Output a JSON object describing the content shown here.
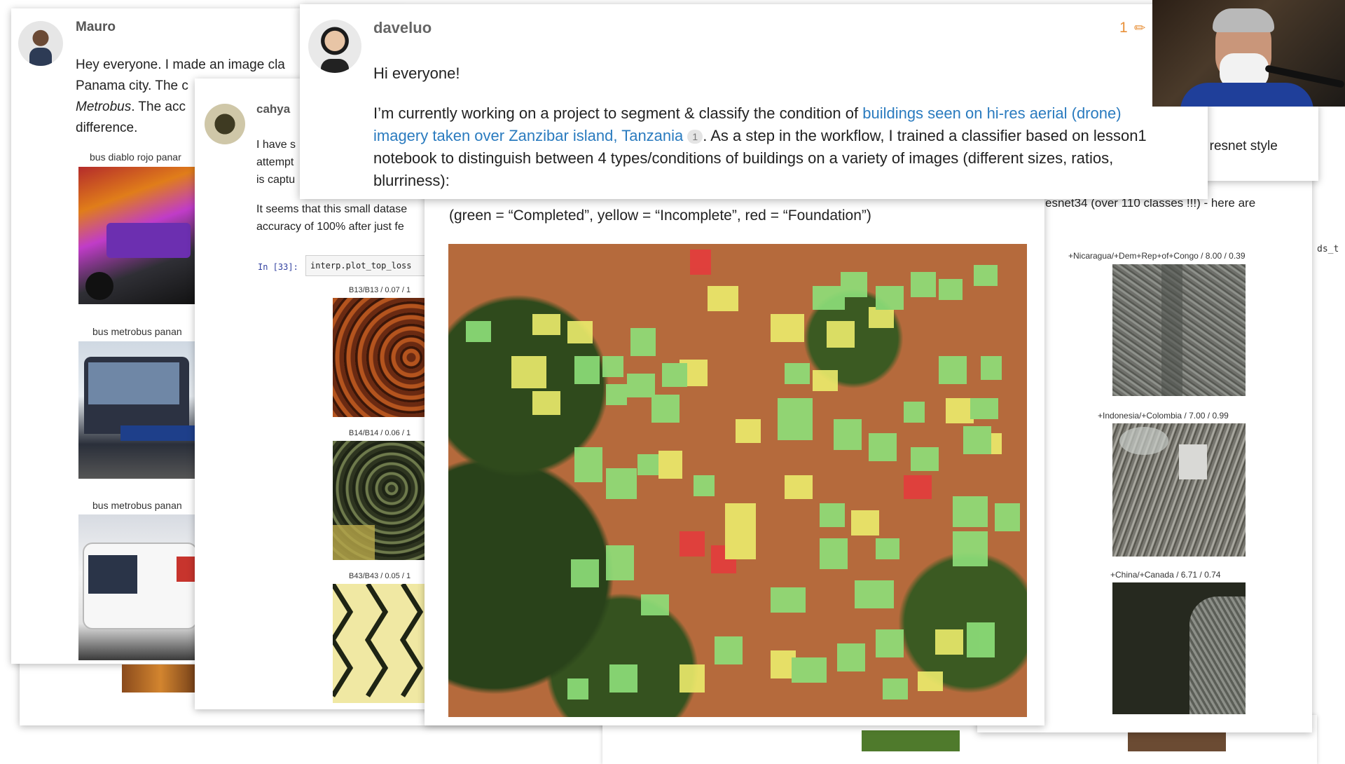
{
  "mauro": {
    "name": "Mauro",
    "line1": "Hey everyone. I made an image cla",
    "line2": "Panama city. The c",
    "line3_em": "Metrobus",
    "line3_rest": ". The acc",
    "line4": "difference.",
    "captions": [
      "bus diablo rojo panar",
      "bus metrobus panan",
      "bus metrobus panan"
    ]
  },
  "cahya": {
    "name": "cahya",
    "p1": [
      "I have s",
      "attempt",
      "is captu"
    ],
    "p2": [
      "It seems that this small datase",
      "accuracy of 100% after just fe"
    ],
    "prompt": "In [33]:",
    "code": "interp.plot_top_loss",
    "captions": [
      "B13/B13 / 0.07 / 1",
      "B14/B14 / 0.06 / 1",
      "B43/B43 / 0.05 / 1"
    ]
  },
  "right_card": {
    "text_top": "y a resnet style",
    "text_mid": "esnet34 (over 110 classes !!!) - here are",
    "captions": [
      "+Nicaragua/+Dem+Rep+of+Congo / 8.00 / 0.39",
      "+Indonesia/+Colombia / 7.00 / 0.99",
      "+China/+Canada / 6.71 / 0.74"
    ],
    "edge_code": "ds_t"
  },
  "daveluo": {
    "name": "daveluo",
    "edit_count": "1",
    "greeting": "Hi everyone!",
    "body_pre": "I’m currently working on a project to segment & classify the condition of ",
    "link_text": "buildings seen on hi-res aerial (drone) imagery taken over Zanzibar island, Tanzania",
    "link_count": "1",
    "body_post": ". As a step in the workflow, I trained a classifier based on lesson1 notebook to distinguish between 4 types/conditions of buildings on a variety of images (different sizes, ratios, blurriness):"
  },
  "legend_text": "(green = “Completed”, yellow = “Incomplete”, red = “Foundation”)",
  "colors": {
    "link": "#2a7bbf",
    "edit": "#e8913a",
    "completed": "#8ee07a",
    "incomplete": "#ecec6c",
    "foundation": "#e43c3c"
  },
  "icons": [
    "pencil-icon"
  ]
}
